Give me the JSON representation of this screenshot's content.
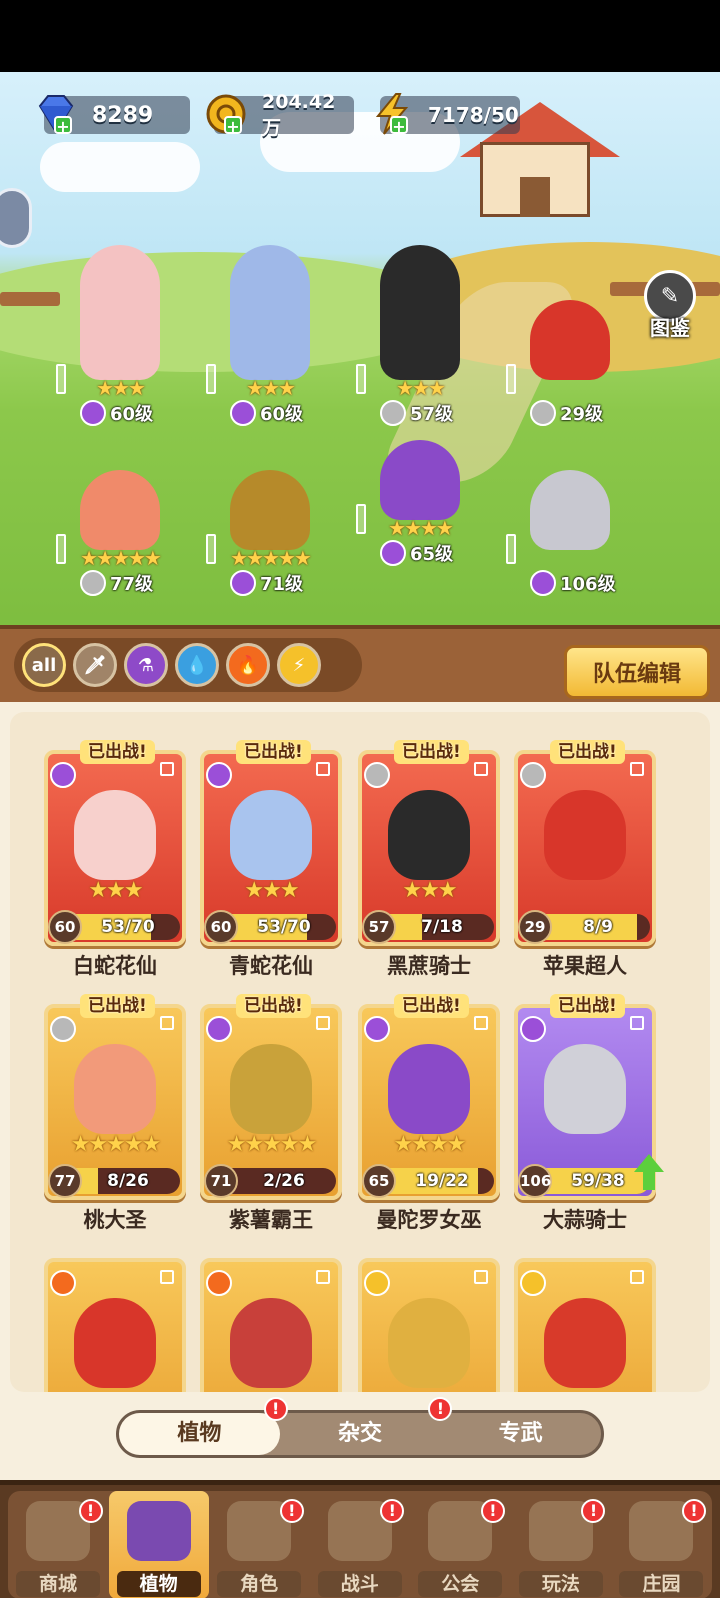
{
  "resources": {
    "gems": "8289",
    "gold": "204.42万",
    "energy": "7178/50"
  },
  "scene_button": "图鉴",
  "team_heroes": [
    {
      "stars": "★★★",
      "level": "60级",
      "element": "purple"
    },
    {
      "stars": "★★★",
      "level": "60级",
      "element": "purple"
    },
    {
      "stars": "★★★",
      "level": "57级",
      "element": "sword"
    },
    {
      "stars": "",
      "level": "29级",
      "element": "sword"
    },
    {
      "stars": "★★★★★",
      "level": "77级",
      "element": "sword"
    },
    {
      "stars": "★★★★★",
      "level": "71级",
      "element": "purple"
    },
    {
      "stars": "★★★★",
      "level": "65级",
      "element": "purple"
    },
    {
      "stars": "",
      "level": "106级",
      "element": "purple"
    }
  ],
  "filters": {
    "all_label": "all",
    "items": [
      "all",
      "sword",
      "potion",
      "water",
      "fire",
      "lightning"
    ]
  },
  "edit_button": "队伍编辑",
  "cards": [
    {
      "name": "白蛇花仙",
      "badge": "已出战!",
      "level": "60",
      "progress": "53/70",
      "ratio": 0.757,
      "stars": "★★★",
      "element": "purple",
      "frame": "red"
    },
    {
      "name": "青蛇花仙",
      "badge": "已出战!",
      "level": "60",
      "progress": "53/70",
      "ratio": 0.757,
      "stars": "★★★",
      "element": "purple",
      "frame": "red"
    },
    {
      "name": "黑蔗骑士",
      "badge": "已出战!",
      "level": "57",
      "progress": "7/18",
      "ratio": 0.389,
      "stars": "★★★",
      "element": "sword",
      "frame": "red"
    },
    {
      "name": "苹果超人",
      "badge": "已出战!",
      "level": "29",
      "progress": "8/9",
      "ratio": 0.889,
      "stars": "",
      "element": "sword",
      "frame": "red"
    },
    {
      "name": "桃大圣",
      "badge": "已出战!",
      "level": "77",
      "progress": "8/26",
      "ratio": 0.308,
      "stars": "★★★★★",
      "element": "sword",
      "frame": "gold"
    },
    {
      "name": "紫薯霸王",
      "badge": "已出战!",
      "level": "71",
      "progress": "2/26",
      "ratio": 0.077,
      "stars": "★★★★★",
      "element": "purple",
      "frame": "gold"
    },
    {
      "name": "曼陀罗女巫",
      "badge": "已出战!",
      "level": "65",
      "progress": "19/22",
      "ratio": 0.864,
      "stars": "★★★★",
      "element": "purple",
      "frame": "gold"
    },
    {
      "name": "大蒜骑士",
      "badge": "已出战!",
      "level": "106",
      "progress": "59/38",
      "ratio": 1.0,
      "stars": "",
      "element": "purple",
      "frame": "purple"
    }
  ],
  "partial_cards": [
    {
      "element": "fire"
    },
    {
      "element": "fire"
    },
    {
      "element": "lightning"
    },
    {
      "element": "lightning"
    }
  ],
  "subtabs": [
    "植物",
    "杂交",
    "专武"
  ],
  "nav": [
    "商城",
    "植物",
    "角色",
    "战斗",
    "公会",
    "玩法",
    "庄园"
  ],
  "colors": {
    "purple": "#9b4fd8",
    "sword": "#b8b8b8",
    "water": "#3a9fe0",
    "fire": "#f36a1e",
    "lightning": "#f5c12a"
  }
}
